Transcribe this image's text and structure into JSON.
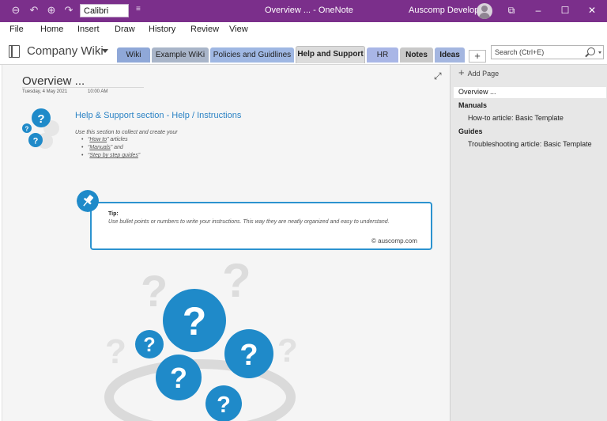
{
  "titlebar": {
    "font_name": "Calibri",
    "app_title": "Overview ...  -  OneNote",
    "user": "Auscomp Developer"
  },
  "menu": [
    "File",
    "Home",
    "Insert",
    "Draw",
    "History",
    "Review",
    "View"
  ],
  "notebook": {
    "name": "Company Wiki",
    "tabs": [
      {
        "label": "Wiki",
        "color": "#8fa8d8"
      },
      {
        "label": "Example WiKi",
        "color": "#a9b5c9"
      },
      {
        "label": "Policies and Guidlines",
        "color": "#9fb7e3"
      },
      {
        "label": "Help and Support",
        "color": "#dcdcdc"
      },
      {
        "label": "HR",
        "color": "#a9b6e6"
      },
      {
        "label": "Notes",
        "color": "#c9c9c9"
      },
      {
        "label": "Ideas",
        "color": "#a4b6e0"
      }
    ],
    "add_tab": "+",
    "search_placeholder": "Search (Ctrl+E)"
  },
  "page": {
    "title": "Overview ...",
    "date": "Tuesday, 4 May 2021",
    "time": "10:00 AM",
    "section_heading": "Help & Support section - Help / Instructions",
    "intro": "Use this section to collect and create your",
    "bullets": [
      {
        "pre": "“",
        "link": "How to",
        "post": "” articles"
      },
      {
        "pre": "“",
        "link": "Manuals",
        "post": "”  and"
      },
      {
        "pre": "“",
        "link": "Step by step guides",
        "post": "”"
      }
    ],
    "tip_label": "Tip:",
    "tip_text": "Use bullet points or numbers to write your instructions. This way they are neatly organized and easy to understand.",
    "tip_credit": "© auscomp.com",
    "question_mark": "?"
  },
  "pages_panel": {
    "add_page": "Add Page",
    "selected": "Overview ...",
    "items": [
      {
        "label": "Manuals",
        "bold": true
      },
      {
        "label": "How-to article: Basic Template",
        "bold": false
      },
      {
        "label": "Guides",
        "bold": true
      },
      {
        "label": "Troubleshooting article: Basic Template",
        "bold": false
      }
    ]
  },
  "colors": {
    "titlebar": "#7b2f8b",
    "accent_blue": "#1f8ac9"
  }
}
